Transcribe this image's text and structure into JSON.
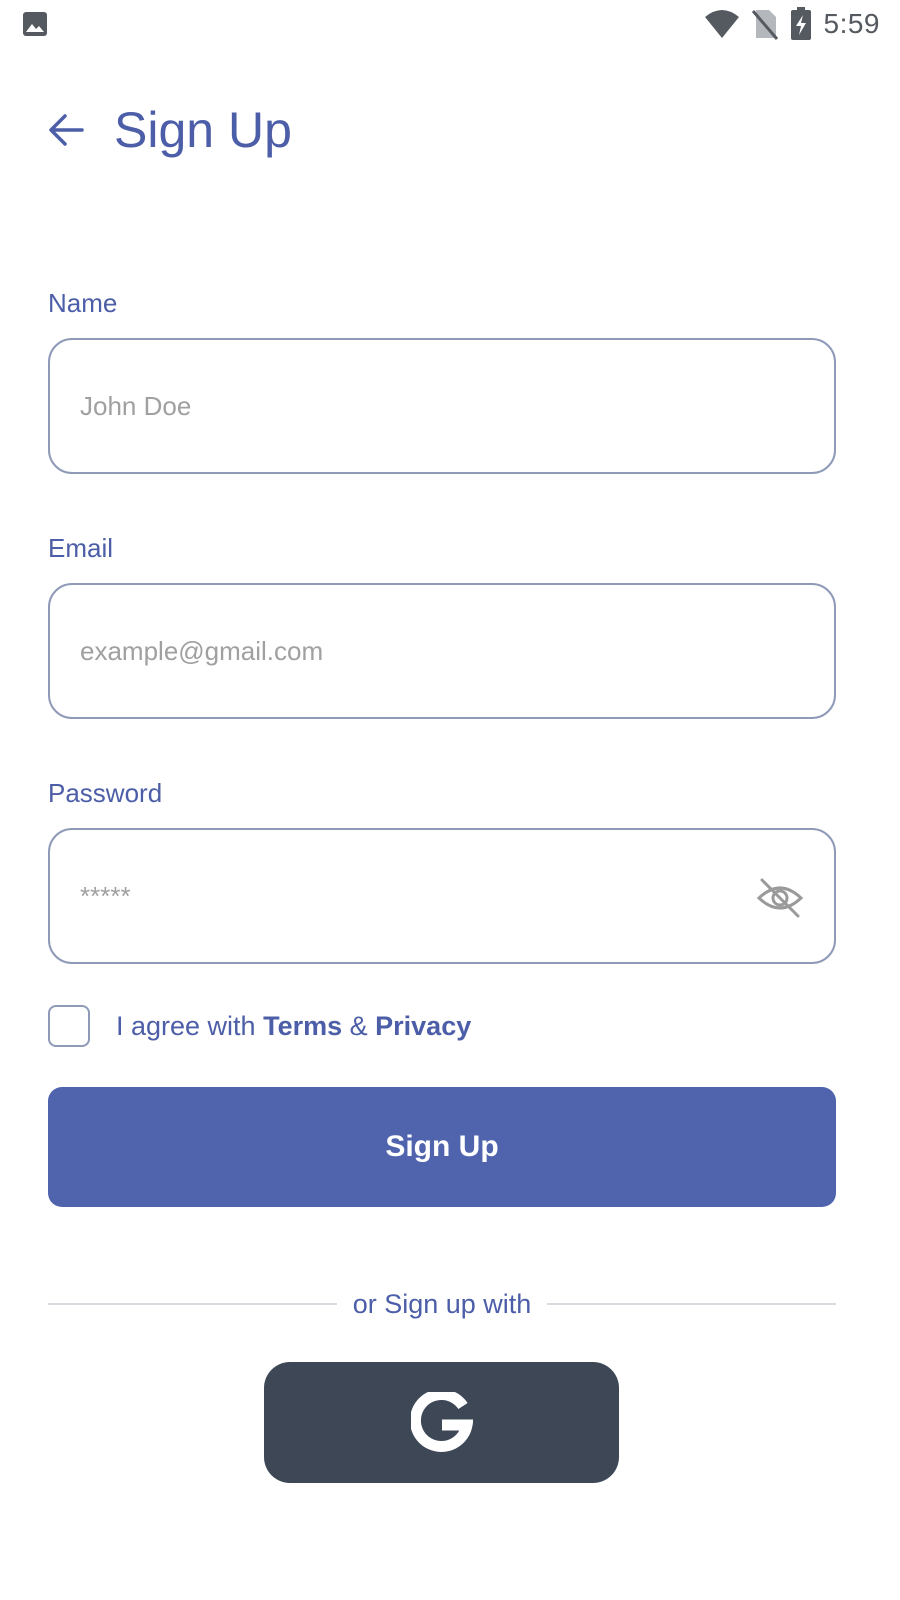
{
  "status_bar": {
    "time": "5:59",
    "left_icon": "image-notification-icon",
    "right_icons": [
      "wifi-icon",
      "no-sim-icon",
      "battery-charging-icon"
    ]
  },
  "header": {
    "back_icon": "arrow-left-icon",
    "title": "Sign Up"
  },
  "form": {
    "name": {
      "label": "Name",
      "placeholder": "John Doe",
      "value": ""
    },
    "email": {
      "label": "Email",
      "placeholder": "example@gmail.com",
      "value": ""
    },
    "password": {
      "label": "Password",
      "placeholder": "*****",
      "value": "",
      "toggle_icon": "eye-off-icon"
    },
    "agree": {
      "checked": false,
      "prefix": "I agree with ",
      "terms_label": "Terms",
      "joiner": " & ",
      "privacy_label": "Privacy"
    },
    "submit_label": "Sign Up"
  },
  "social": {
    "divider_text": "or Sign up with",
    "google_icon": "google-icon"
  },
  "colors": {
    "accent": "#4c5ea8",
    "button_primary": "#5064ae",
    "button_google": "#3d4756",
    "field_border": "#8e9ab8",
    "placeholder": "#a0a0a0"
  }
}
